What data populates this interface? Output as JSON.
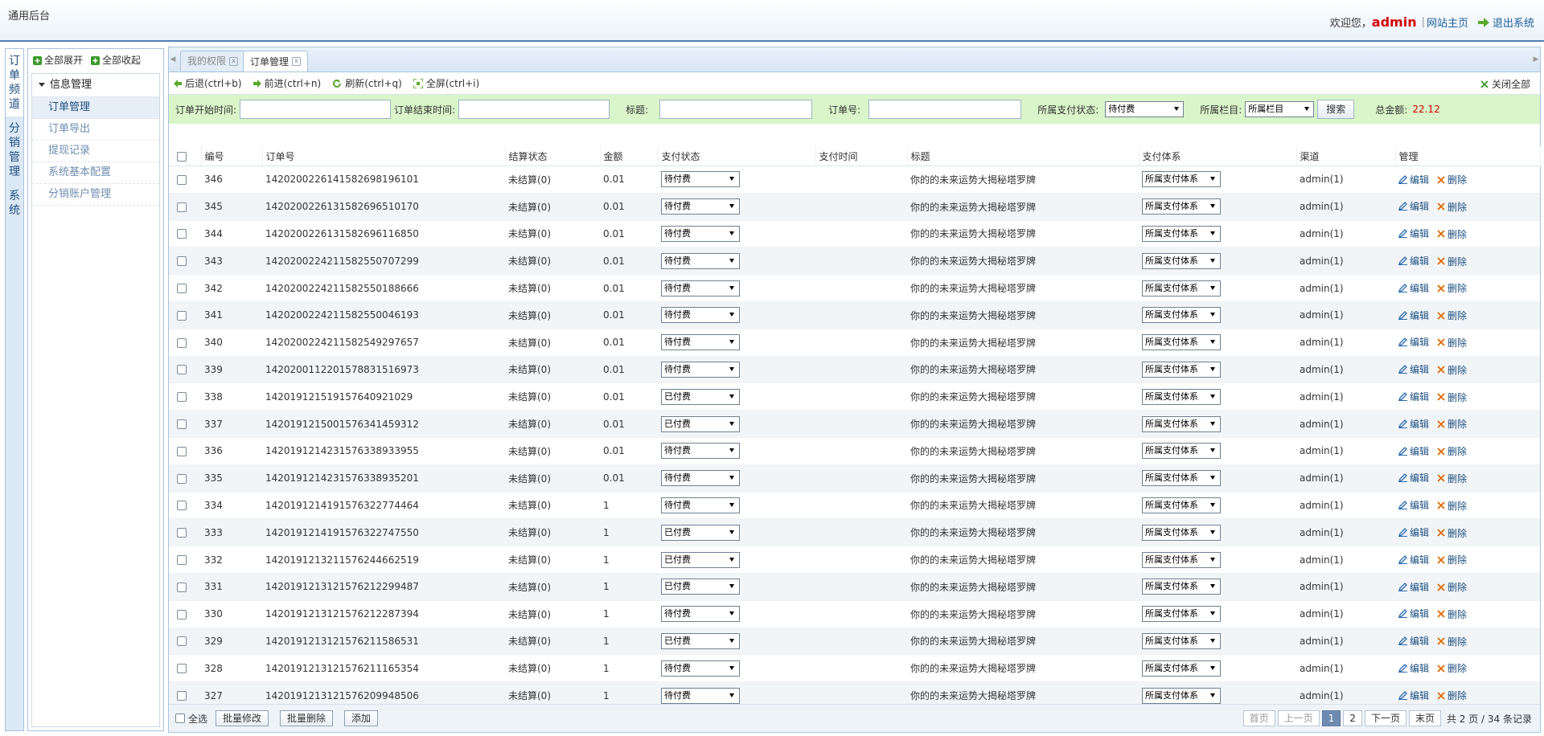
{
  "app": {
    "title": "通用后台",
    "welcome": "欢迎您，",
    "username": "admin",
    "site_home": "网站主页",
    "logout": "退出系统"
  },
  "channels": [
    {
      "label": "订单频道",
      "active": true
    },
    {
      "label": "分销管理",
      "active": false
    },
    {
      "label": "系统",
      "active": false
    }
  ],
  "tree": {
    "expand_all": "全部展开",
    "collapse_all": "全部收起",
    "group": "信息管理",
    "items": [
      {
        "label": "订单管理",
        "active": true
      },
      {
        "label": "订单导出",
        "active": false
      },
      {
        "label": "提现记录",
        "active": false
      },
      {
        "label": "系统基本配置",
        "active": false
      },
      {
        "label": "分销账户管理",
        "active": false
      }
    ]
  },
  "tabs": [
    {
      "label": "我的权限",
      "active": false
    },
    {
      "label": "订单管理",
      "active": true
    }
  ],
  "toolbar": {
    "back": "后退(ctrl+b)",
    "forward": "前进(ctrl+n)",
    "refresh": "刷新(ctrl+q)",
    "fullscreen": "全屏(ctrl+i)",
    "close_all": "关闭全部"
  },
  "filters": {
    "start_label": "订单开始时间:",
    "end_label": "订单结束时间:",
    "title_label": "标题:",
    "order_no_label": "订单号:",
    "pay_status_label": "所属支付状态:",
    "pay_status_value": "待付费",
    "column_label": "所属栏目:",
    "column_value": "所属栏目",
    "search_button": "搜索",
    "total_label": "总金额:",
    "total_value": "22.12"
  },
  "table": {
    "headers": [
      "编号",
      "订单号",
      "结算状态",
      "金额",
      "支付状态",
      "支付时间",
      "标题",
      "支付体系",
      "渠道",
      "管理"
    ],
    "edit_label": "编辑",
    "delete_label": "删除",
    "rows": [
      {
        "id": "346",
        "order_no": "142020022614158269819610​1",
        "settle": "未结算(0)",
        "amount": "0.01",
        "pay_status": "待付费",
        "pay_time": "",
        "title": "你的的未来运势大揭秘塔罗牌",
        "pay_system": "所属支付体系",
        "channel": "admin(1)"
      },
      {
        "id": "345",
        "order_no": "1420200226131582696510170",
        "settle": "未结算(0)",
        "amount": "0.01",
        "pay_status": "待付费",
        "pay_time": "",
        "title": "你的的未来运势大揭秘塔罗牌",
        "pay_system": "所属支付体系",
        "channel": "admin(1)"
      },
      {
        "id": "344",
        "order_no": "1420200226131582696116850",
        "settle": "未结算(0)",
        "amount": "0.01",
        "pay_status": "待付费",
        "pay_time": "",
        "title": "你的的未来运势大揭秘塔罗牌",
        "pay_system": "所属支付体系",
        "channel": "admin(1)"
      },
      {
        "id": "343",
        "order_no": "1420200224211582550707299",
        "settle": "未结算(0)",
        "amount": "0.01",
        "pay_status": "待付费",
        "pay_time": "",
        "title": "你的的未来运势大揭秘塔罗牌",
        "pay_system": "所属支付体系",
        "channel": "admin(1)"
      },
      {
        "id": "342",
        "order_no": "1420200224211582550188666",
        "settle": "未结算(0)",
        "amount": "0.01",
        "pay_status": "待付费",
        "pay_time": "",
        "title": "你的的未来运势大揭秘塔罗牌",
        "pay_system": "所属支付体系",
        "channel": "admin(1)"
      },
      {
        "id": "341",
        "order_no": "1420200224211582550046193",
        "settle": "未结算(0)",
        "amount": "0.01",
        "pay_status": "待付费",
        "pay_time": "",
        "title": "你的的未来运势大揭秘塔罗牌",
        "pay_system": "所属支付体系",
        "channel": "admin(1)"
      },
      {
        "id": "340",
        "order_no": "1420200224211582549297657",
        "settle": "未结算(0)",
        "amount": "0.01",
        "pay_status": "待付费",
        "pay_time": "",
        "title": "你的的未来运势大揭秘塔罗牌",
        "pay_system": "所属支付体系",
        "channel": "admin(1)"
      },
      {
        "id": "339",
        "order_no": "1420200112201578831516973",
        "settle": "未结算(0)",
        "amount": "0.01",
        "pay_status": "待付费",
        "pay_time": "",
        "title": "你的的未来运势大揭秘塔罗牌",
        "pay_system": "所属支付体系",
        "channel": "admin(1)"
      },
      {
        "id": "338",
        "order_no": "1420191215191576409210​29",
        "settle": "未结算(0)",
        "amount": "0.01",
        "pay_status": "已付费",
        "pay_time": "",
        "title": "你的的未来运势大揭秘塔罗牌",
        "pay_system": "所属支付体系",
        "channel": "admin(1)"
      },
      {
        "id": "337",
        "order_no": "1420191215001576341459312",
        "settle": "未结算(0)",
        "amount": "0.01",
        "pay_status": "已付费",
        "pay_time": "",
        "title": "你的的未来运势大揭秘塔罗牌",
        "pay_system": "所属支付体系",
        "channel": "admin(1)"
      },
      {
        "id": "336",
        "order_no": "1420191214231576338933955",
        "settle": "未结算(0)",
        "amount": "0.01",
        "pay_status": "待付费",
        "pay_time": "",
        "title": "你的的未来运势大揭秘塔罗牌",
        "pay_system": "所属支付体系",
        "channel": "admin(1)"
      },
      {
        "id": "335",
        "order_no": "1420191214231576338935201",
        "settle": "未结算(0)",
        "amount": "0.01",
        "pay_status": "待付费",
        "pay_time": "",
        "title": "你的的未来运势大揭秘塔罗牌",
        "pay_system": "所属支付体系",
        "channel": "admin(1)"
      },
      {
        "id": "334",
        "order_no": "1420191214191576322774464",
        "settle": "未结算(0)",
        "amount": "1",
        "pay_status": "待付费",
        "pay_time": "",
        "title": "你的的未来运势大揭秘塔罗牌",
        "pay_system": "所属支付体系",
        "channel": "admin(1)"
      },
      {
        "id": "333",
        "order_no": "1420191214191576322747550",
        "settle": "未结算(0)",
        "amount": "1",
        "pay_status": "已付费",
        "pay_time": "",
        "title": "你的的未来运势大揭秘塔罗牌",
        "pay_system": "所属支付体系",
        "channel": "admin(1)"
      },
      {
        "id": "332",
        "order_no": "1420191213211576244662519",
        "settle": "未结算(0)",
        "amount": "1",
        "pay_status": "已付费",
        "pay_time": "",
        "title": "你的的未来运势大揭秘塔罗牌",
        "pay_system": "所属支付体系",
        "channel": "admin(1)"
      },
      {
        "id": "331",
        "order_no": "1420191213121576212299487",
        "settle": "未结算(0)",
        "amount": "1",
        "pay_status": "已付费",
        "pay_time": "",
        "title": "你的的未来运势大揭秘塔罗牌",
        "pay_system": "所属支付体系",
        "channel": "admin(1)"
      },
      {
        "id": "330",
        "order_no": "1420191213121576212287394",
        "settle": "未结算(0)",
        "amount": "1",
        "pay_status": "待付费",
        "pay_time": "",
        "title": "你的的未来运势大揭秘塔罗牌",
        "pay_system": "所属支付体系",
        "channel": "admin(1)"
      },
      {
        "id": "329",
        "order_no": "1420191213121576211586531",
        "settle": "未结算(0)",
        "amount": "1",
        "pay_status": "已付费",
        "pay_time": "",
        "title": "你的的未来运势大揭秘塔罗牌",
        "pay_system": "所属支付体系",
        "channel": "admin(1)"
      },
      {
        "id": "328",
        "order_no": "1420191213121576211165354",
        "settle": "未结算(0)",
        "amount": "1",
        "pay_status": "待付费",
        "pay_time": "",
        "title": "你的的未来运势大揭秘塔罗牌",
        "pay_system": "所属支付体系",
        "channel": "admin(1)"
      },
      {
        "id": "327",
        "order_no": "1420191213121576209948506",
        "settle": "未结算(0)",
        "amount": "1",
        "pay_status": "待付费",
        "pay_time": "",
        "title": "你的的未来运势大揭秘塔罗牌",
        "pay_system": "所属支付体系",
        "channel": "admin(1)"
      }
    ]
  },
  "footer": {
    "select_all": "全选",
    "batch_edit": "批量修改",
    "batch_delete": "批量删除",
    "add": "添加"
  },
  "pager": {
    "first": "首页",
    "prev": "上一页",
    "pages": [
      "1",
      "2"
    ],
    "current": "1",
    "next": "下一页",
    "last": "末页",
    "summary": "共 2 页 / 34 条记录"
  },
  "colors": {
    "accent": "#4e7fb0",
    "filter_bg": "#d9f5c9",
    "username": "#d40000",
    "total": "#d40000"
  }
}
